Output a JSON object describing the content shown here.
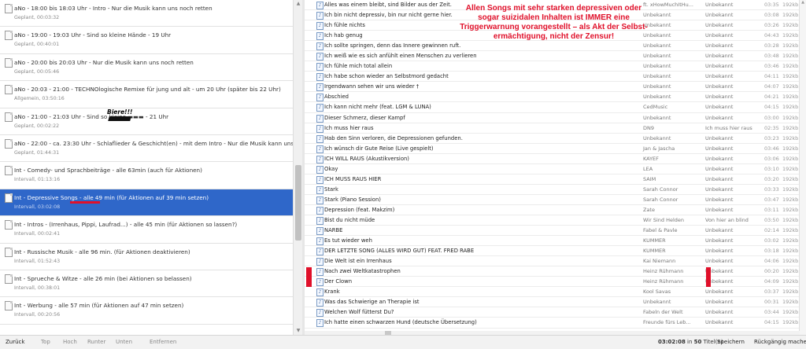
{
  "schedule": [
    {
      "title": "aNo - 18:00 bis 18:03 Uhr - Intro - Nur die Musik kann uns noch retten",
      "sub": "Geplant, 00:03:32"
    },
    {
      "title": "aNo - 19:00 - 19:03 Uhr - Sind so kleine Hände - 19 Uhr",
      "sub": "Geplant, 00:40:01"
    },
    {
      "title": "aNo - 20:00 bis 20:03 Uhr - Nur die Musik kann uns noch retten",
      "sub": "Geplant, 00:05:46"
    },
    {
      "title": "aNo - 20:03 - 21:00 - TECHNOlogische Remixe für jung und alt - um 20 Uhr (später bis 22 Uhr)",
      "sub": "Allgemein, 03:50:16"
    },
    {
      "title": "aNo - 21:00 - 21:03 Uhr - Sind so kleine ▬▬▬ - 21 Uhr",
      "sub": "Geplant, 00:02:22"
    },
    {
      "title": "aNo - 22:00 - ca. 23:30 Uhr - Schlaflieder & Geschicht(en) - mit dem Intro - Nur die Musik kann uns noch retten",
      "sub": "Geplant, 01:44:31"
    },
    {
      "title": "Int - Comedy- und Sprachbeiträge - alle 63min (auch für Aktionen)",
      "sub": "Intervall, 01:13:16"
    },
    {
      "title": "Int - Depressive Songs - alle 49 min (für Aktionen auf 39 min setzen)",
      "sub": "Intervall, 03:02:08"
    },
    {
      "title": "Int - Intros - (Irrenhaus, Pippi, Laufrad...) - alle 45 min (für Aktionen so lassen?)",
      "sub": "Intervall, 00:02:41"
    },
    {
      "title": "Int - Russische Musik - alle 96 min. (für Aktionen deaktivieren)",
      "sub": "Intervall, 01:52:43"
    },
    {
      "title": "Int - Sprueche & Witze - alle 26 min (bei Aktionen so belassen)",
      "sub": "Intervall, 00:38:01"
    },
    {
      "title": "Int - Werbung - alle 57 min (für Aktionen auf 47 min setzen)",
      "sub": "Intervall, 00:20:56"
    }
  ],
  "annotation_bier": "Biere!!!",
  "warning_text": "Allen Songs mit sehr starken depressiven oder sogar suizidalen Inhalten ist IMMER eine Triggerwarnung vorangestellt – als Akt der Selbst-ermächtigung, nicht der Zensur!",
  "songs": [
    {
      "title": "Alles was einem bleibt, sind Bilder aus der Zeit.",
      "artist": "ft. xHowMuchItHu...",
      "album": "Unbekannt",
      "duration": "03:35",
      "bitrate": "192kb..."
    },
    {
      "title": "Ich bin nicht depressiv, bin nur nicht gerne hier.",
      "artist": "Unbekannt",
      "album": "Unbekannt",
      "duration": "03:08",
      "bitrate": "192kb..."
    },
    {
      "title": "Ich fühle nichts",
      "artist": "Unbekannt",
      "album": "Unbekannt",
      "duration": "03:26",
      "bitrate": "192kb..."
    },
    {
      "title": "Ich hab genug",
      "artist": "Unbekannt",
      "album": "Unbekannt",
      "duration": "04:43",
      "bitrate": "192kb..."
    },
    {
      "title": "Ich sollte springen, denn das Innere gewinnen ruft.",
      "artist": "Unbekannt",
      "album": "Unbekannt",
      "duration": "03:28",
      "bitrate": "192kb..."
    },
    {
      "title": "Ich weiß wie es sich anfühlt einen Menschen zu verlieren",
      "artist": "Unbekannt",
      "album": "Unbekannt",
      "duration": "03:48",
      "bitrate": "192kb..."
    },
    {
      "title": "Ich fühle mich total allein",
      "artist": "Unbekannt",
      "album": "Unbekannt",
      "duration": "03:46",
      "bitrate": "192kb..."
    },
    {
      "title": "Ich habe schon wieder an Selbstmord gedacht",
      "artist": "Unbekannt",
      "album": "Unbekannt",
      "duration": "04:11",
      "bitrate": "192kb..."
    },
    {
      "title": "Irgendwann sehen wir uns wieder †",
      "artist": "Unbekannt",
      "album": "Unbekannt",
      "duration": "04:07",
      "bitrate": "192kb..."
    },
    {
      "title": "Abschied",
      "artist": "Unbekannt",
      "album": "Unbekannt",
      "duration": "04:21",
      "bitrate": "192kb..."
    },
    {
      "title": "Ich kann nicht mehr (feat. LGM & LUNA)",
      "artist": "CedMusic",
      "album": "Unbekannt",
      "duration": "04:15",
      "bitrate": "192kb..."
    },
    {
      "title": "Dieser Schmerz, dieser Kampf",
      "artist": "Unbekannt",
      "album": "Unbekannt",
      "duration": "03:00",
      "bitrate": "192kb..."
    },
    {
      "title": "Ich muss hier raus",
      "artist": "DN9",
      "album": "Ich muss hier raus",
      "duration": "02:35",
      "bitrate": "192kb..."
    },
    {
      "title": "Hab den Sinn verloren, die Depressionen gefunden.",
      "artist": "Unbekannt",
      "album": "Unbekannt",
      "duration": "03:23",
      "bitrate": "192kb..."
    },
    {
      "title": "Ich wünsch dir Gute Reise (Live gespielt)",
      "artist": "Jan & Jascha",
      "album": "Unbekannt",
      "duration": "03:46",
      "bitrate": "192kb..."
    },
    {
      "title": "ICH WILL RAUS (Akustikversion)",
      "artist": "KAYEF",
      "album": "Unbekannt",
      "duration": "03:06",
      "bitrate": "192kb..."
    },
    {
      "title": "Okay",
      "artist": "LEA",
      "album": "Unbekannt",
      "duration": "03:10",
      "bitrate": "192kb..."
    },
    {
      "title": "ICH MUSS RAUS HIER",
      "artist": "SAIM",
      "album": "Unbekannt",
      "duration": "03:20",
      "bitrate": "192kb..."
    },
    {
      "title": "Stark",
      "artist": "Sarah Connor",
      "album": "Unbekannt",
      "duration": "03:33",
      "bitrate": "192kb..."
    },
    {
      "title": "Stark (Piano Session)",
      "artist": "Sarah Connor",
      "album": "Unbekannt",
      "duration": "03:47",
      "bitrate": "192kb..."
    },
    {
      "title": "Depression (feat. Makzim)",
      "artist": "Zate",
      "album": "Unbekannt",
      "duration": "03:11",
      "bitrate": "192kb..."
    },
    {
      "title": "Bist du nicht müde",
      "artist": "Wir Sind Helden",
      "album": "Von hier an blind",
      "duration": "03:50",
      "bitrate": "192kb..."
    },
    {
      "title": "NARBE",
      "artist": "Fabel & Pavle",
      "album": "Unbekannt",
      "duration": "02:14",
      "bitrate": "192kb..."
    },
    {
      "title": "Es tut wieder weh",
      "artist": "KUMMER",
      "album": "Unbekannt",
      "duration": "03:02",
      "bitrate": "192kb..."
    },
    {
      "title": "DER LETZTE SONG (ALLES WIRD GUT) FEAT. FRED RABE",
      "artist": "KUMMER",
      "album": "Unbekannt",
      "duration": "03:18",
      "bitrate": "192kb..."
    },
    {
      "title": "Die Welt ist ein Irrenhaus",
      "artist": "Kai Niemann",
      "album": "Unbekannt",
      "duration": "04:06",
      "bitrate": "192kb..."
    },
    {
      "title": "Nach zwei Weltkatastrophen",
      "artist": "Heinz Rühmann",
      "album": "Unbekannt",
      "duration": "00:20",
      "bitrate": "192kb..."
    },
    {
      "title": "Der Clown",
      "artist": "Heinz Rühmann",
      "album": "Unbekannt",
      "duration": "04:09",
      "bitrate": "192kb..."
    },
    {
      "title": "Krank",
      "artist": "Kool Savas",
      "album": "Unbekannt",
      "duration": "03:37",
      "bitrate": "192kb..."
    },
    {
      "title": "Was das Schwierige an Therapie ist",
      "artist": "Unbekannt",
      "album": "Unbekannt",
      "duration": "00:31",
      "bitrate": "192kb..."
    },
    {
      "title": "Welchen Wolf fütterst Du?",
      "artist": "Fabeln der Welt",
      "album": "Unbekannt",
      "duration": "03:44",
      "bitrate": "192kb..."
    },
    {
      "title": "Ich hatte einen schwarzen Hund (deutsche Übersetzung)",
      "artist": "Freunde fürs Leb...",
      "album": "Unbekannt",
      "duration": "04:15",
      "bitrate": "192kb..."
    }
  ],
  "bottom_bar": {
    "back": "Zurück",
    "top": "Top",
    "up": "Hoch",
    "down": "Runter",
    "bottom": "Unten",
    "remove": "Entfernen",
    "total_time": "03:02:08",
    "in_label": " in ",
    "count": "50",
    "titles_label": " Titel(n)",
    "save": "Speichern",
    "undo": "Rückgängig machen"
  }
}
